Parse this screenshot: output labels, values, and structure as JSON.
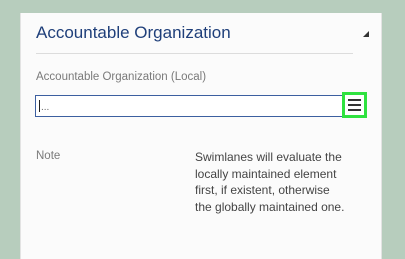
{
  "panel": {
    "title": "Accountable Organization",
    "field_label": "Accountable Organization (Local)",
    "field_value": "...",
    "note_label": "Note",
    "note_text": "Swimlanes will evaluate the locally maintained element first, if existent, otherwise the globally maintained one."
  },
  "icons": {
    "collapse": "collapse-triangle-icon",
    "menu": "hamburger-menu-icon"
  },
  "colors": {
    "background": "#b7cdbd",
    "title": "#1f3f7a",
    "field_border": "#3c5fa0",
    "highlight": "#2fe23f"
  }
}
